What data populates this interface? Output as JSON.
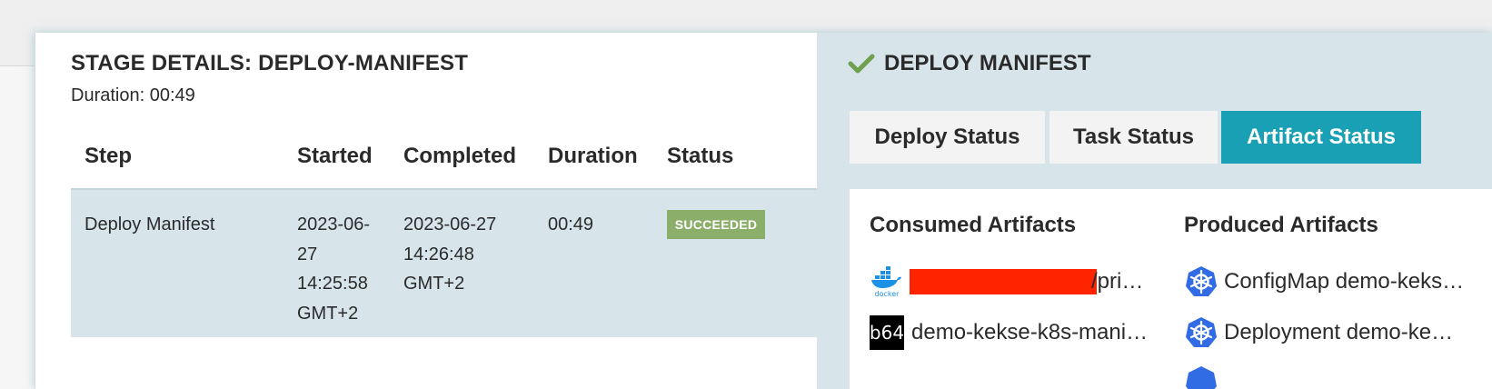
{
  "stage": {
    "title": "STAGE DETAILS: DEPLOY-MANIFEST",
    "duration_line": "Duration: 00:49",
    "columns": [
      "Step",
      "Started",
      "Completed",
      "Duration",
      "Status"
    ],
    "row": {
      "step": "Deploy Manifest",
      "started": [
        "2023-06-",
        "27",
        "14:25:58",
        "GMT+2"
      ],
      "completed": [
        "2023-06-27",
        "14:26:48",
        "GMT+2"
      ],
      "duration": "00:49",
      "status": "SUCCEEDED"
    }
  },
  "panel": {
    "title": "DEPLOY MANIFEST",
    "tabs": [
      "Deploy Status",
      "Task Status",
      "Artifact Status"
    ],
    "active_tab": "Artifact Status",
    "consumed_header": "Consumed Artifacts",
    "produced_header": "Produced Artifacts",
    "consumed": [
      {
        "icon": "docker-icon",
        "text": "/pri…",
        "redacted": true
      },
      {
        "icon": "b64",
        "icon_text": "b64",
        "text": "demo-kekse-k8s-mani…"
      }
    ],
    "produced": [
      {
        "icon": "kubernetes-icon",
        "text": "ConfigMap demo-keks…"
      },
      {
        "icon": "kubernetes-icon",
        "text": "Deployment demo-ke…"
      }
    ]
  },
  "colors": {
    "accent": "#1aa0b4",
    "success": "#8bae6a",
    "panel_bg": "#d7e5eb",
    "check": "#6fa04f",
    "redaction": "#ff2400",
    "kubernetes": "#326ce5",
    "docker": "#1d91e6"
  }
}
